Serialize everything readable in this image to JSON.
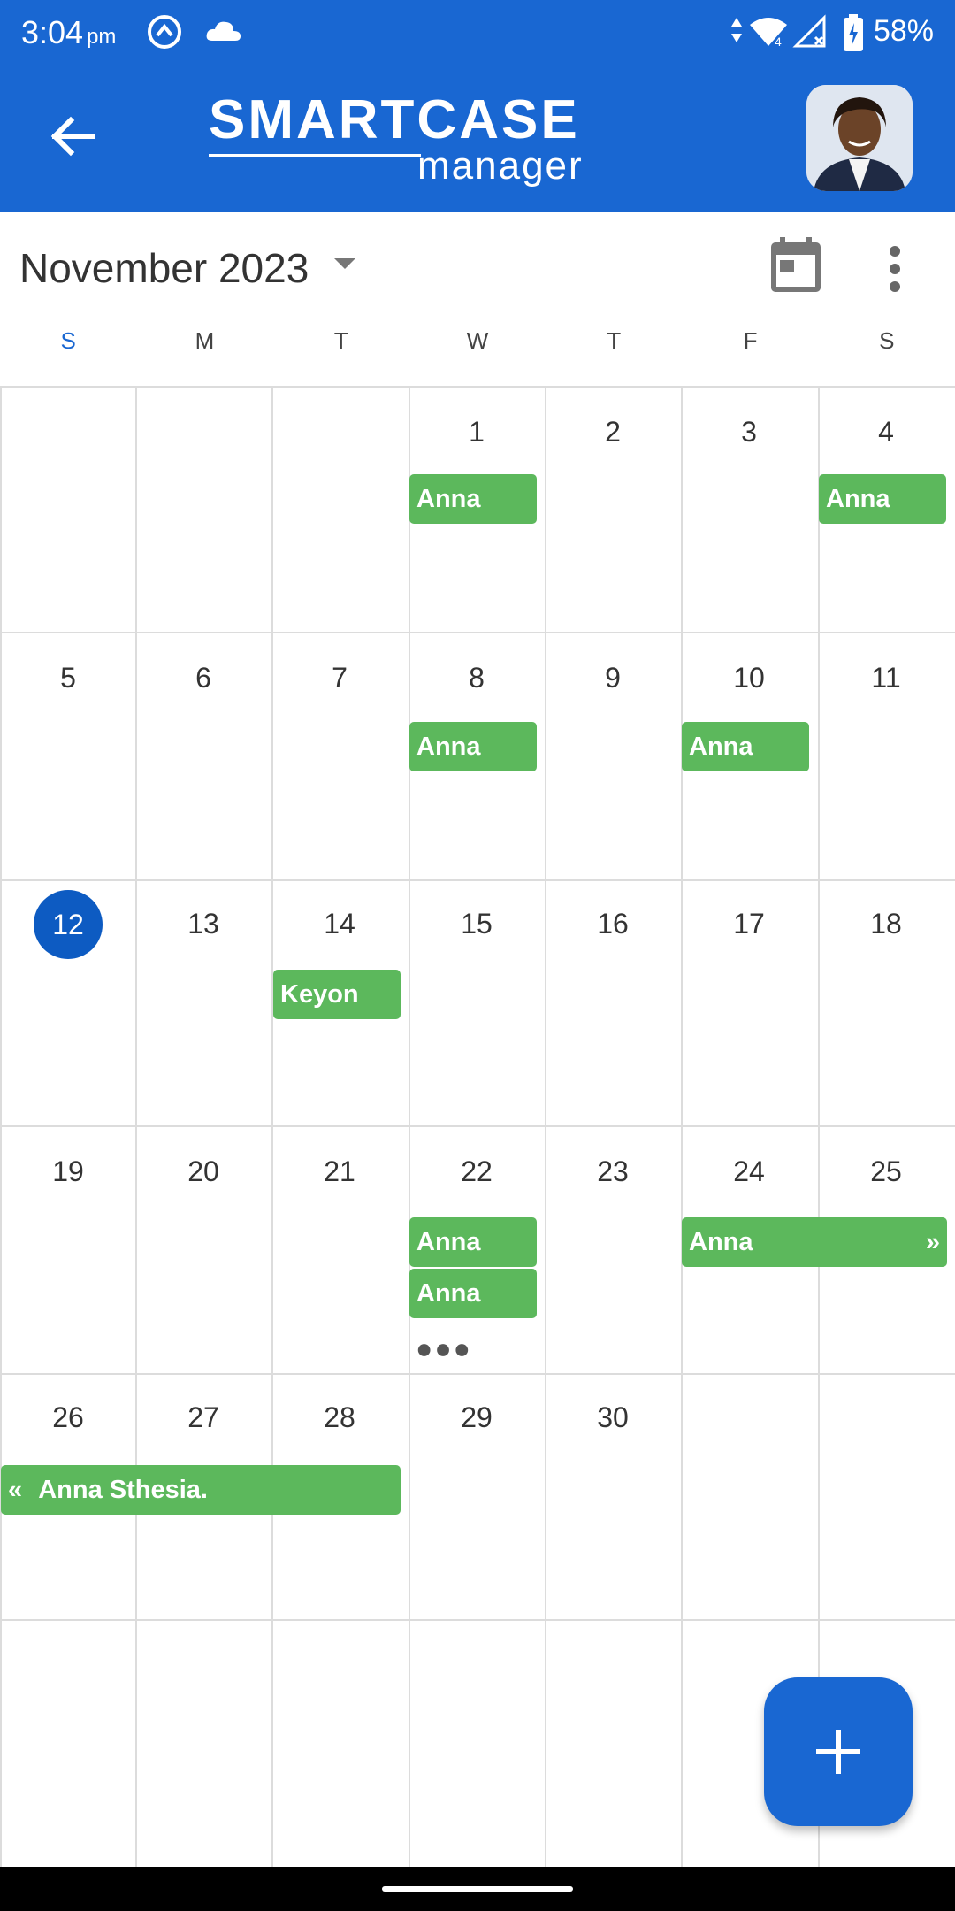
{
  "status_bar": {
    "time": "3:04",
    "ampm": "pm",
    "battery": "58%"
  },
  "app_bar": {
    "logo_main": "SMARTCASE",
    "logo_sub": "manager",
    "colors": {
      "primary": "#1967d2",
      "event": "#5cb85c",
      "today": "#0d5bc2"
    }
  },
  "calendar": {
    "month_label": "November 2023",
    "weekdays": [
      "S",
      "M",
      "T",
      "W",
      "T",
      "F",
      "S"
    ],
    "weeks": [
      [
        "",
        "",
        "",
        "1",
        "2",
        "3",
        "4"
      ],
      [
        "5",
        "6",
        "7",
        "8",
        "9",
        "10",
        "11"
      ],
      [
        "12",
        "13",
        "14",
        "15",
        "16",
        "17",
        "18"
      ],
      [
        "19",
        "20",
        "21",
        "22",
        "23",
        "24",
        "25"
      ],
      [
        "26",
        "27",
        "28",
        "29",
        "30",
        "",
        ""
      ],
      [
        "",
        "",
        "",
        "",
        "",
        "",
        ""
      ]
    ],
    "today": "12",
    "events": [
      {
        "label": "Anna"
      },
      {
        "label": "Anna"
      },
      {
        "label": "Anna"
      },
      {
        "label": "Anna"
      },
      {
        "label": "Keyon"
      },
      {
        "label": "Anna"
      },
      {
        "label": "Anna"
      },
      {
        "label": "Anna",
        "continues": "»"
      },
      {
        "label": "Anna Sthesia.",
        "continued": "«"
      }
    ],
    "more_indicator": "●●●"
  },
  "fab": {
    "icon": "plus-icon"
  }
}
